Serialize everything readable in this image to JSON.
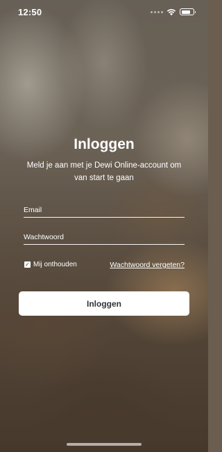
{
  "status_bar": {
    "time": "12:50",
    "battery_level_percent": 80
  },
  "login": {
    "title": "Inloggen",
    "subtitle": "Meld je aan met je Dewi Online-account om van start te gaan",
    "email_placeholder": "Email",
    "password_placeholder": "Wachtwoord",
    "remember_label": "Mij onthouden",
    "remember_checked": true,
    "forgot_password_label": "Wachtwoord vergeten?",
    "submit_label": "Inloggen"
  },
  "colors": {
    "button_bg": "#ffffff",
    "button_text": "#333333",
    "text": "#ffffff"
  },
  "icons": {
    "signal": "signal-dots-icon",
    "wifi": "wifi-icon",
    "battery": "battery-icon",
    "checkbox": "checkmark-icon"
  }
}
